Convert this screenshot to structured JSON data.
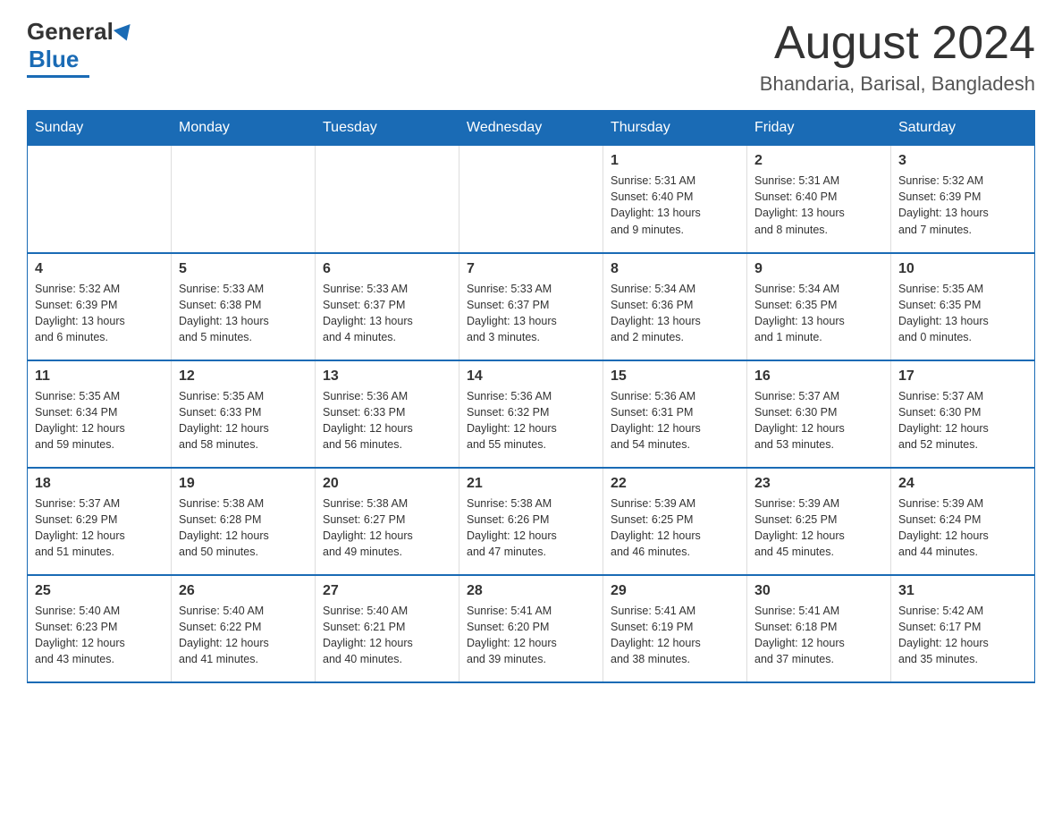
{
  "header": {
    "logo_general": "General",
    "logo_blue": "Blue",
    "month_title": "August 2024",
    "location": "Bhandaria, Barisal, Bangladesh"
  },
  "weekdays": [
    "Sunday",
    "Monday",
    "Tuesday",
    "Wednesday",
    "Thursday",
    "Friday",
    "Saturday"
  ],
  "weeks": [
    [
      {
        "day": "",
        "info": ""
      },
      {
        "day": "",
        "info": ""
      },
      {
        "day": "",
        "info": ""
      },
      {
        "day": "",
        "info": ""
      },
      {
        "day": "1",
        "info": "Sunrise: 5:31 AM\nSunset: 6:40 PM\nDaylight: 13 hours\nand 9 minutes."
      },
      {
        "day": "2",
        "info": "Sunrise: 5:31 AM\nSunset: 6:40 PM\nDaylight: 13 hours\nand 8 minutes."
      },
      {
        "day": "3",
        "info": "Sunrise: 5:32 AM\nSunset: 6:39 PM\nDaylight: 13 hours\nand 7 minutes."
      }
    ],
    [
      {
        "day": "4",
        "info": "Sunrise: 5:32 AM\nSunset: 6:39 PM\nDaylight: 13 hours\nand 6 minutes."
      },
      {
        "day": "5",
        "info": "Sunrise: 5:33 AM\nSunset: 6:38 PM\nDaylight: 13 hours\nand 5 minutes."
      },
      {
        "day": "6",
        "info": "Sunrise: 5:33 AM\nSunset: 6:37 PM\nDaylight: 13 hours\nand 4 minutes."
      },
      {
        "day": "7",
        "info": "Sunrise: 5:33 AM\nSunset: 6:37 PM\nDaylight: 13 hours\nand 3 minutes."
      },
      {
        "day": "8",
        "info": "Sunrise: 5:34 AM\nSunset: 6:36 PM\nDaylight: 13 hours\nand 2 minutes."
      },
      {
        "day": "9",
        "info": "Sunrise: 5:34 AM\nSunset: 6:35 PM\nDaylight: 13 hours\nand 1 minute."
      },
      {
        "day": "10",
        "info": "Sunrise: 5:35 AM\nSunset: 6:35 PM\nDaylight: 13 hours\nand 0 minutes."
      }
    ],
    [
      {
        "day": "11",
        "info": "Sunrise: 5:35 AM\nSunset: 6:34 PM\nDaylight: 12 hours\nand 59 minutes."
      },
      {
        "day": "12",
        "info": "Sunrise: 5:35 AM\nSunset: 6:33 PM\nDaylight: 12 hours\nand 58 minutes."
      },
      {
        "day": "13",
        "info": "Sunrise: 5:36 AM\nSunset: 6:33 PM\nDaylight: 12 hours\nand 56 minutes."
      },
      {
        "day": "14",
        "info": "Sunrise: 5:36 AM\nSunset: 6:32 PM\nDaylight: 12 hours\nand 55 minutes."
      },
      {
        "day": "15",
        "info": "Sunrise: 5:36 AM\nSunset: 6:31 PM\nDaylight: 12 hours\nand 54 minutes."
      },
      {
        "day": "16",
        "info": "Sunrise: 5:37 AM\nSunset: 6:30 PM\nDaylight: 12 hours\nand 53 minutes."
      },
      {
        "day": "17",
        "info": "Sunrise: 5:37 AM\nSunset: 6:30 PM\nDaylight: 12 hours\nand 52 minutes."
      }
    ],
    [
      {
        "day": "18",
        "info": "Sunrise: 5:37 AM\nSunset: 6:29 PM\nDaylight: 12 hours\nand 51 minutes."
      },
      {
        "day": "19",
        "info": "Sunrise: 5:38 AM\nSunset: 6:28 PM\nDaylight: 12 hours\nand 50 minutes."
      },
      {
        "day": "20",
        "info": "Sunrise: 5:38 AM\nSunset: 6:27 PM\nDaylight: 12 hours\nand 49 minutes."
      },
      {
        "day": "21",
        "info": "Sunrise: 5:38 AM\nSunset: 6:26 PM\nDaylight: 12 hours\nand 47 minutes."
      },
      {
        "day": "22",
        "info": "Sunrise: 5:39 AM\nSunset: 6:25 PM\nDaylight: 12 hours\nand 46 minutes."
      },
      {
        "day": "23",
        "info": "Sunrise: 5:39 AM\nSunset: 6:25 PM\nDaylight: 12 hours\nand 45 minutes."
      },
      {
        "day": "24",
        "info": "Sunrise: 5:39 AM\nSunset: 6:24 PM\nDaylight: 12 hours\nand 44 minutes."
      }
    ],
    [
      {
        "day": "25",
        "info": "Sunrise: 5:40 AM\nSunset: 6:23 PM\nDaylight: 12 hours\nand 43 minutes."
      },
      {
        "day": "26",
        "info": "Sunrise: 5:40 AM\nSunset: 6:22 PM\nDaylight: 12 hours\nand 41 minutes."
      },
      {
        "day": "27",
        "info": "Sunrise: 5:40 AM\nSunset: 6:21 PM\nDaylight: 12 hours\nand 40 minutes."
      },
      {
        "day": "28",
        "info": "Sunrise: 5:41 AM\nSunset: 6:20 PM\nDaylight: 12 hours\nand 39 minutes."
      },
      {
        "day": "29",
        "info": "Sunrise: 5:41 AM\nSunset: 6:19 PM\nDaylight: 12 hours\nand 38 minutes."
      },
      {
        "day": "30",
        "info": "Sunrise: 5:41 AM\nSunset: 6:18 PM\nDaylight: 12 hours\nand 37 minutes."
      },
      {
        "day": "31",
        "info": "Sunrise: 5:42 AM\nSunset: 6:17 PM\nDaylight: 12 hours\nand 35 minutes."
      }
    ]
  ]
}
